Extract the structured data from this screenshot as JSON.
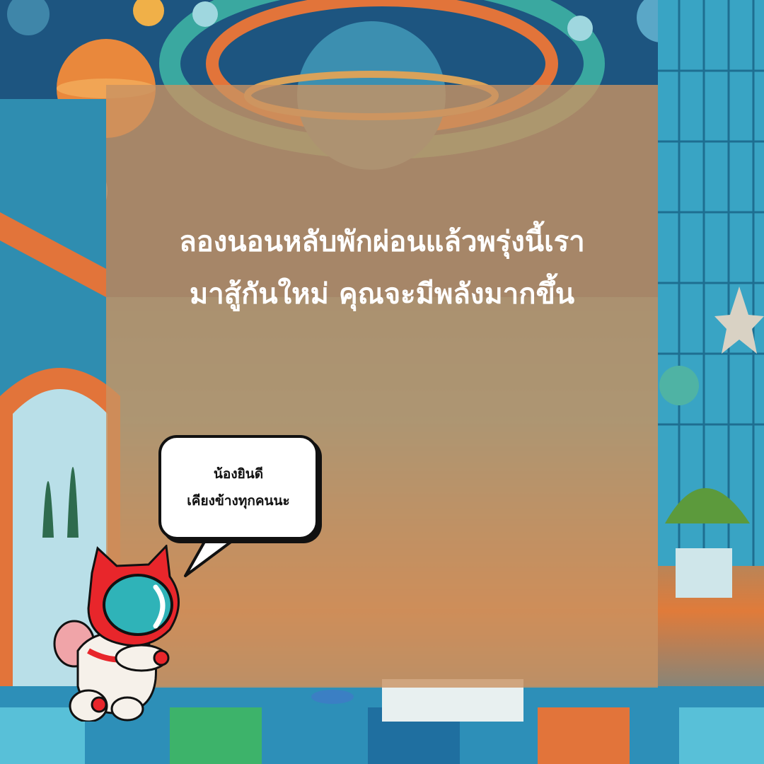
{
  "headline": {
    "line1": "ลองนอนหลับพักผ่อนแล้วพรุ่งนี้เรา",
    "line2": "มาสู้กันใหม่ คุณจะมีพลังมากขึ้น"
  },
  "speech_bubble": {
    "line1": "น้องยินดี",
    "line2": "เคียงข้างทุกคนนะ"
  },
  "colors": {
    "overlay": "#c99262",
    "text": "#ffffff",
    "bubble_border": "#111111",
    "mascot_red": "#e8262b",
    "visor_teal": "#2fb3b8"
  }
}
